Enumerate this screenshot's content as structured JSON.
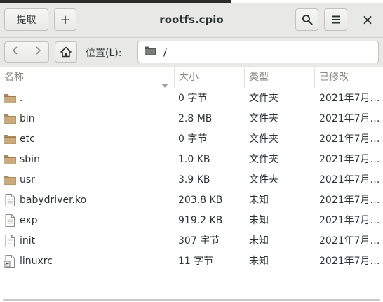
{
  "window": {
    "title": "rootfs.cpio",
    "extract_label": "提取",
    "add_label": "+",
    "close_label": "×"
  },
  "location": {
    "label": "位置(L):",
    "path": "/"
  },
  "columns": {
    "name": "名称",
    "size": "大小",
    "type": "类型",
    "modified": "已修改"
  },
  "files": [
    {
      "name": ".",
      "size": "0 字节",
      "type": "文件夹",
      "modified": "2021年7月…",
      "icon": "folder-icon"
    },
    {
      "name": "bin",
      "size": "2.8 MB",
      "type": "文件夹",
      "modified": "2021年7月…",
      "icon": "folder-icon"
    },
    {
      "name": "etc",
      "size": "0 字节",
      "type": "文件夹",
      "modified": "2021年7月…",
      "icon": "folder-icon"
    },
    {
      "name": "sbin",
      "size": "1.0 KB",
      "type": "文件夹",
      "modified": "2021年7月…",
      "icon": "folder-icon"
    },
    {
      "name": "usr",
      "size": "3.9 KB",
      "type": "文件夹",
      "modified": "2021年7月…",
      "icon": "folder-icon"
    },
    {
      "name": "babydriver.ko",
      "size": "203.8 KB",
      "type": "未知",
      "modified": "2021年7月…",
      "icon": "file-icon"
    },
    {
      "name": "exp",
      "size": "919.2 KB",
      "type": "未知",
      "modified": "2021年7月…",
      "icon": "file-icon"
    },
    {
      "name": "init",
      "size": "307 字节",
      "type": "未知",
      "modified": "2021年7月…",
      "icon": "file-icon"
    },
    {
      "name": "linuxrc",
      "size": "11 字节",
      "type": "未知",
      "modified": "2021年7月…",
      "icon": "symlink-icon"
    }
  ]
}
